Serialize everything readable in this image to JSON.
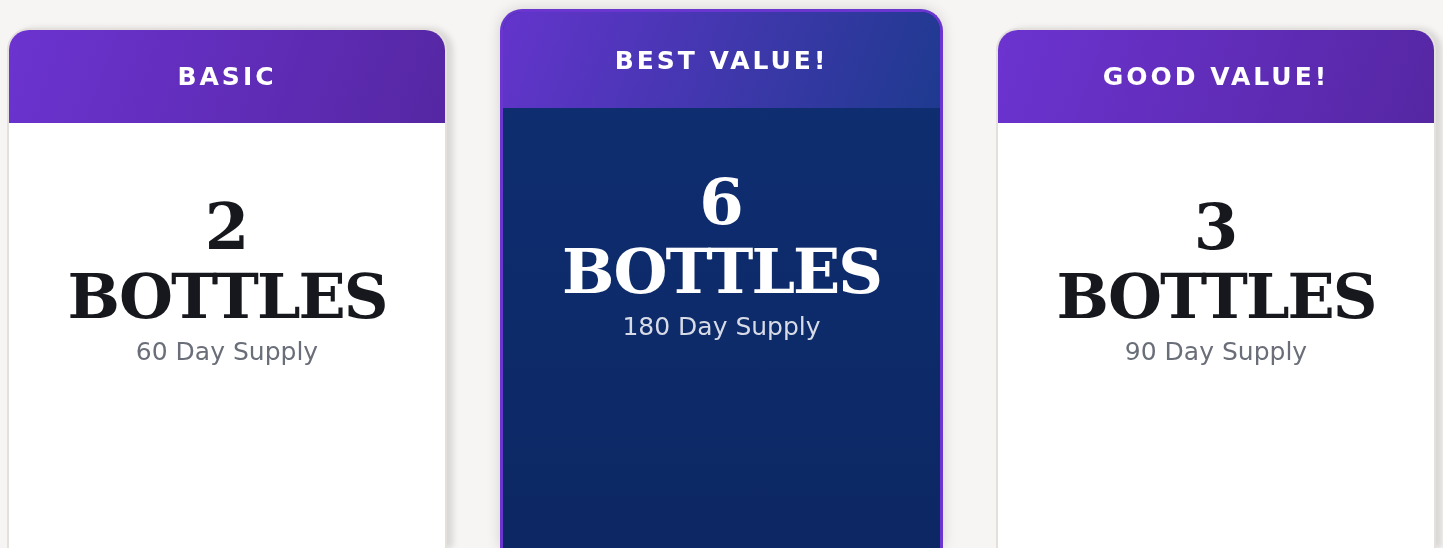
{
  "plans": [
    {
      "label": "BASIC",
      "quantity": "2",
      "unit": "BOTTLES",
      "supply": "60 Day Supply",
      "featured": false
    },
    {
      "label": "BEST VALUE!",
      "quantity": "6",
      "unit": "BOTTLES",
      "supply": "180 Day Supply",
      "featured": true
    },
    {
      "label": "GOOD VALUE!",
      "quantity": "3",
      "unit": "BOTTLES",
      "supply": "90 Day Supply",
      "featured": false
    }
  ]
}
